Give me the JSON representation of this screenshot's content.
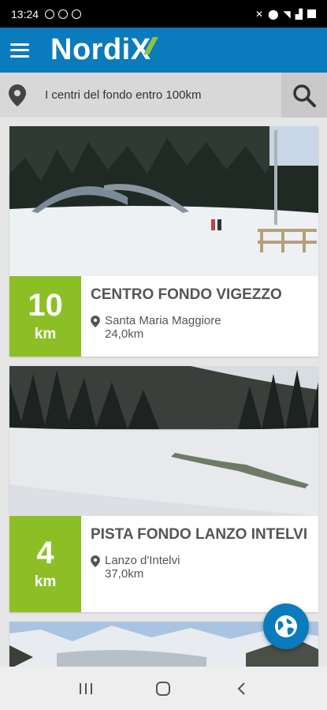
{
  "status_bar": {
    "time": "13:24"
  },
  "app": {
    "logo": "Nordi",
    "logo_x": "X"
  },
  "search": {
    "text": "I centri del fondo entro 100km"
  },
  "centers": [
    {
      "km": "10",
      "unit": "km",
      "name": "CENTRO FONDO VIGEZZO",
      "location": "Santa Maria Maggiore",
      "distance": "24,0km"
    },
    {
      "km": "4",
      "unit": "km",
      "name": "PISTA FONDO LANZO INTELVI",
      "location": "Lanzo d'Intelvi",
      "distance": "37,0km"
    }
  ],
  "colors": {
    "primary": "#0a7bbd",
    "accent": "#8cbf26"
  },
  "icons": {
    "menu": "menu-icon",
    "location": "location-pin-icon",
    "search": "search-icon",
    "globe": "globe-icon"
  }
}
